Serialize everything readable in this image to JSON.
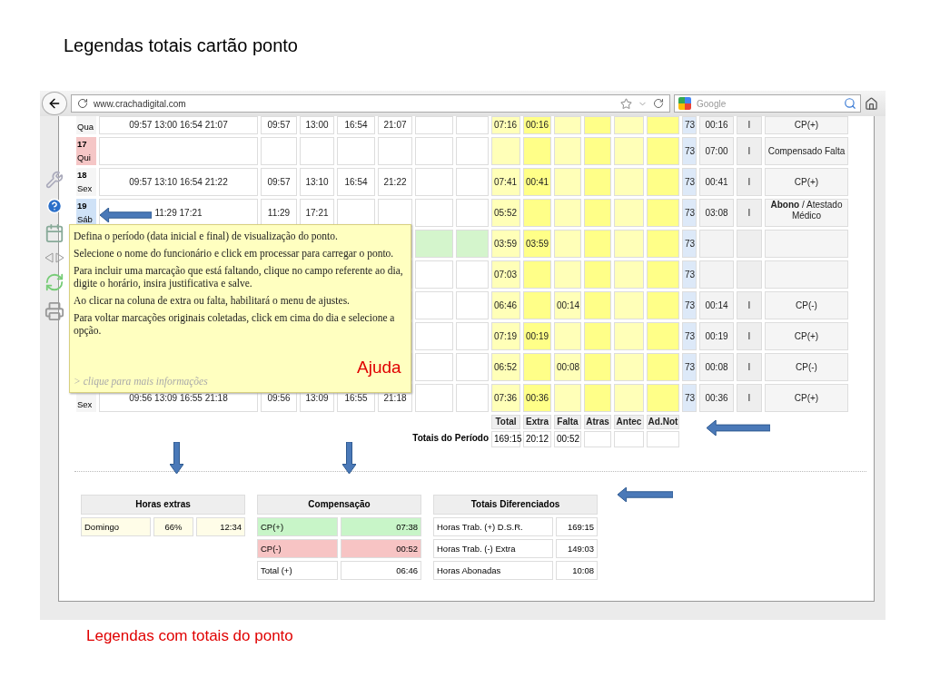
{
  "slide_title": "Legendas totais cartão ponto",
  "browser": {
    "url": "www.crachadigital.com",
    "search_placeholder": "Google"
  },
  "table": {
    "rows": [
      {
        "weekday": "Qua",
        "highlight": false,
        "punches": "09:57  13:00  16:54  21:07",
        "times": [
          "09:57",
          "13:00",
          "16:54",
          "21:07"
        ],
        "total": "07:16",
        "extra": "00:16",
        "code": "73",
        "balance": "00:16",
        "flag": "I",
        "note": "CP(+)"
      },
      {
        "day": "17",
        "weekday": "Qui",
        "color": "#f5c6c6",
        "highlight": false,
        "code": "73",
        "balance": "07:00",
        "flag": "I",
        "note": "Compensado Falta"
      },
      {
        "day": "18",
        "weekday": "Sex",
        "highlight": false,
        "punches": "09:57  13:10  16:54  21:22",
        "times": [
          "09:57",
          "13:10",
          "16:54",
          "21:22"
        ],
        "total": "07:41",
        "extra": "00:41",
        "code": "73",
        "balance": "00:41",
        "flag": "I",
        "note": "CP(+)"
      },
      {
        "day": "19",
        "weekday": "Sáb",
        "color": "#cfe2f7",
        "highlight": false,
        "punches": "11:29  17:21",
        "times": [
          "11:29",
          "17:21"
        ],
        "total": "05:52",
        "code": "73",
        "balance": "03:08",
        "flag": "I",
        "note": "**Abono** / Atestado Médico"
      },
      {
        "highlight": true,
        "total": "03:59",
        "extra": "03:59",
        "code": "73"
      },
      {
        "highlight": false,
        "total": "07:03",
        "code": "73"
      },
      {
        "highlight": false,
        "total": "06:46",
        "falta": "00:14",
        "code": "73",
        "balance": "00:14",
        "flag": "I",
        "note": "CP(-)"
      },
      {
        "highlight": false,
        "total": "07:19",
        "extra": "00:19",
        "code": "73",
        "balance": "00:19",
        "flag": "I",
        "note": "CP(+)"
      },
      {
        "highlight": false,
        "total": "06:52",
        "falta": "00:08",
        "code": "73",
        "balance": "00:08",
        "flag": "I",
        "note": "CP(-)"
      },
      {
        "weekday": "Sex",
        "highlight": false,
        "punches": "09:56  13:09  16:55  21:18",
        "times": [
          "09:56",
          "13:09",
          "16:55",
          "21:18"
        ],
        "total": "07:36",
        "extra": "00:36",
        "code": "73",
        "balance": "00:36",
        "flag": "I",
        "note": "CP(+)"
      }
    ],
    "totals_header": [
      "Total",
      "Extra",
      "Falta",
      "Atras",
      "Antec",
      "Ad.Not"
    ],
    "totals_label": "Totais do Período",
    "totals": [
      "169:15",
      "20:12",
      "00:52"
    ]
  },
  "tooltip": {
    "paragraphs": [
      "Defina o período (data inicial e final) de visualização do ponto.",
      "Selecione o nome do funcionário e click em processar para carregar o ponto.",
      "Para incluir uma marcação que está faltando, clique no campo referente ao dia, digite o horário, insira justificativa e salve.",
      "Ao clicar na coluna de extra ou falta, habilitará o menu de ajustes.",
      "Para voltar marcações originais coletadas, click em cima do dia e selecione a opção."
    ],
    "link": "> clique para mais informações"
  },
  "annotation_label": "Ajuda",
  "horas_extras": {
    "title": "Horas extras",
    "rows": [
      [
        "Domingo",
        "66%",
        "12:34"
      ]
    ]
  },
  "compensacao": {
    "title": "Compensação",
    "rows": [
      {
        "label": "CP(+)",
        "value": "07:38",
        "kind": "positive"
      },
      {
        "label": "CP(-)",
        "value": "00:52",
        "kind": "negative"
      },
      {
        "label": "Total (+)",
        "value": "06:46",
        "kind": "total"
      }
    ]
  },
  "totais_diferenciados": {
    "title": "Totais Diferenciados",
    "rows": [
      {
        "label": "Horas Trab. (+) D.S.R.",
        "value": "169:15"
      },
      {
        "label": "Horas Trab. (-) Extra",
        "value": "149:03"
      },
      {
        "label": "Horas Abonadas",
        "value": "10:08"
      }
    ]
  },
  "caption": "Legendas com totais do ponto"
}
